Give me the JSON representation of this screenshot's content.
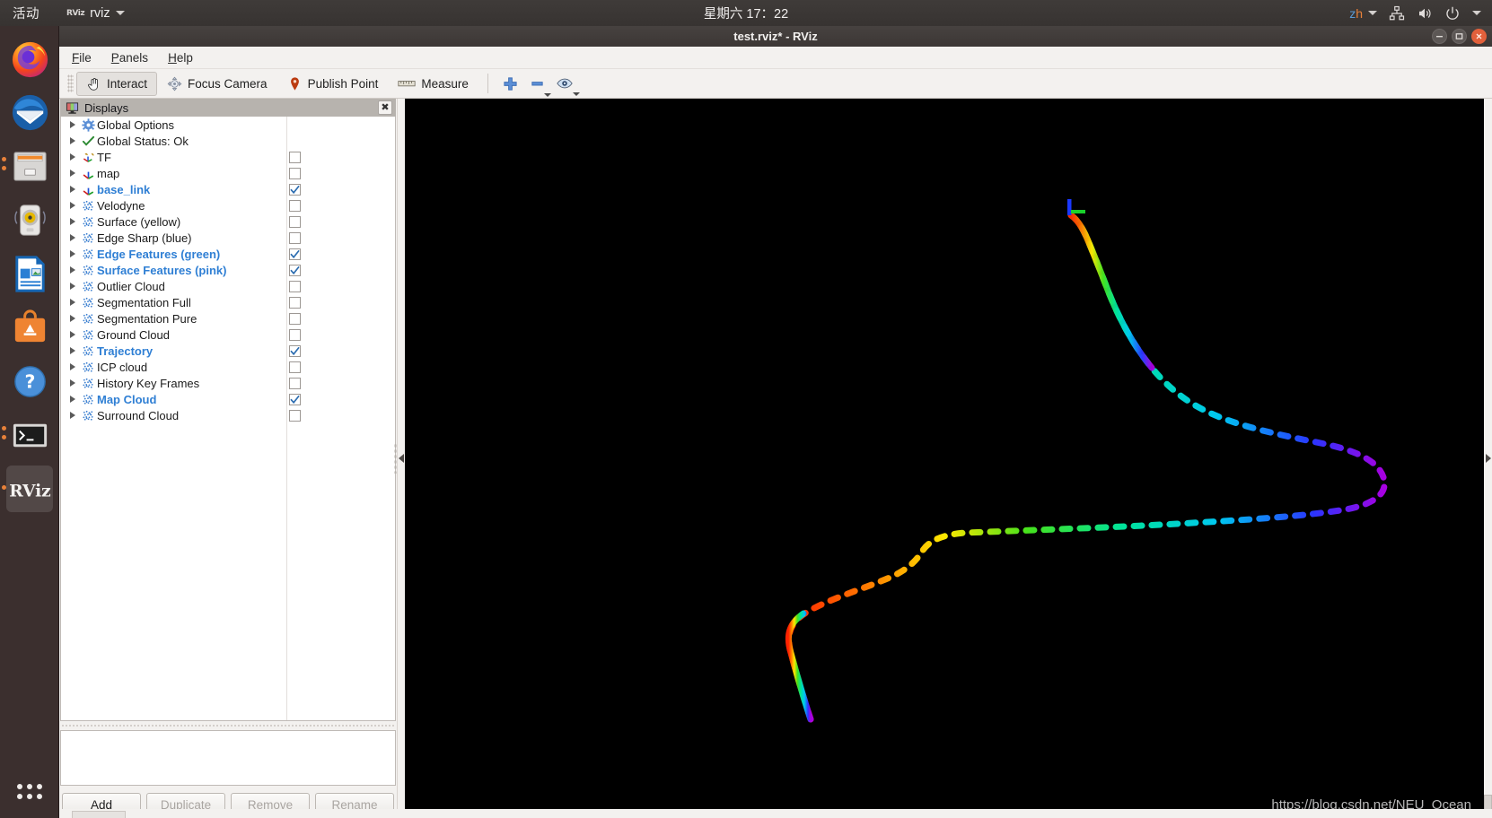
{
  "topbar": {
    "activities": "活动",
    "app_logo": "RViz",
    "app_name": "rviz",
    "clock": "星期六 17：22",
    "language": "zh",
    "icons": [
      "network-icon",
      "volume-icon",
      "power-icon",
      "chevron-down-icon"
    ]
  },
  "dock": {
    "items": [
      {
        "name": "firefox",
        "running": false
      },
      {
        "name": "thunderbird",
        "running": false
      },
      {
        "name": "files",
        "running": true
      },
      {
        "name": "rhythmbox",
        "running": false
      },
      {
        "name": "libreoffice-writer",
        "running": false
      },
      {
        "name": "ubuntu-software",
        "running": false
      },
      {
        "name": "help",
        "running": false
      },
      {
        "name": "terminal",
        "running": true
      },
      {
        "name": "rviz",
        "running": true,
        "active": true
      }
    ],
    "show_apps_label": "Show Applications"
  },
  "window": {
    "title": "test.rviz* - RViz",
    "controls": [
      "minimize-icon",
      "maximize-icon",
      "close-icon"
    ]
  },
  "menubar": {
    "items": [
      {
        "label": "File",
        "mnemonic": "F"
      },
      {
        "label": "Panels",
        "mnemonic": "P"
      },
      {
        "label": "Help",
        "mnemonic": "H"
      }
    ]
  },
  "toolbar": {
    "buttons": [
      {
        "label": "Interact",
        "icon": "hand-cursor-icon",
        "active": true
      },
      {
        "label": "Focus Camera",
        "icon": "focus-camera-icon",
        "active": false
      },
      {
        "label": "Publish Point",
        "icon": "map-pin-icon",
        "active": false
      },
      {
        "label": "Measure",
        "icon": "ruler-icon",
        "active": false
      }
    ],
    "icon_buttons": [
      {
        "name": "add-tool-icon"
      },
      {
        "name": "remove-tool-icon"
      },
      {
        "name": "view-eye-icon"
      }
    ]
  },
  "displays_panel": {
    "header": "Displays",
    "header_icon": "displays-monitor-icon",
    "close_label": "✖",
    "items": [
      {
        "label": "Global Options",
        "icon": "gear-icon",
        "checkbox": null,
        "highlighted": false
      },
      {
        "label": "Global Status: Ok",
        "icon": "check-icon",
        "checkbox": null,
        "highlighted": false
      },
      {
        "label": "TF",
        "icon": "tf-axes-icon",
        "checkbox": false,
        "highlighted": false
      },
      {
        "label": "map",
        "icon": "axes-icon",
        "checkbox": false,
        "highlighted": false
      },
      {
        "label": "base_link",
        "icon": "axes-icon",
        "checkbox": true,
        "highlighted": true
      },
      {
        "label": "Velodyne",
        "icon": "pointcloud-icon",
        "checkbox": false,
        "highlighted": false
      },
      {
        "label": "Surface (yellow)",
        "icon": "pointcloud-icon",
        "checkbox": false,
        "highlighted": false
      },
      {
        "label": "Edge Sharp (blue)",
        "icon": "pointcloud-icon",
        "checkbox": false,
        "highlighted": false
      },
      {
        "label": "Edge Features (green)",
        "icon": "pointcloud-icon",
        "checkbox": true,
        "highlighted": true
      },
      {
        "label": "Surface Features (pink)",
        "icon": "pointcloud-icon",
        "checkbox": true,
        "highlighted": true
      },
      {
        "label": "Outlier Cloud",
        "icon": "pointcloud-icon",
        "checkbox": false,
        "highlighted": false
      },
      {
        "label": "Segmentation Full",
        "icon": "pointcloud-icon",
        "checkbox": false,
        "highlighted": false
      },
      {
        "label": "Segmentation Pure",
        "icon": "pointcloud-icon",
        "checkbox": false,
        "highlighted": false
      },
      {
        "label": "Ground Cloud",
        "icon": "pointcloud-icon",
        "checkbox": false,
        "highlighted": false
      },
      {
        "label": "Trajectory",
        "icon": "pointcloud-icon",
        "checkbox": true,
        "highlighted": true
      },
      {
        "label": "ICP cloud",
        "icon": "pointcloud-icon",
        "checkbox": false,
        "highlighted": false
      },
      {
        "label": "History Key Frames",
        "icon": "pointcloud-icon",
        "checkbox": false,
        "highlighted": false
      },
      {
        "label": "Map Cloud",
        "icon": "pointcloud-icon",
        "checkbox": true,
        "highlighted": true
      },
      {
        "label": "Surround Cloud",
        "icon": "pointcloud-icon",
        "checkbox": false,
        "highlighted": false
      }
    ],
    "buttons": [
      {
        "label": "Add",
        "enabled": true
      },
      {
        "label": "Duplicate",
        "enabled": false
      },
      {
        "label": "Remove",
        "enabled": false
      },
      {
        "label": "Rename",
        "enabled": false
      }
    ]
  },
  "view3d": {
    "background_color": "#000000",
    "watermark": "https://blog.csdn.net/NEU_Ocean",
    "trajectory_note": "rainbow-colored dotted trajectory path",
    "trajectory_colors": [
      "#ff2200",
      "#ff7700",
      "#ffee00",
      "#33dd22",
      "#00e0a0",
      "#00d0ff",
      "#2040ff",
      "#9900dd"
    ]
  }
}
